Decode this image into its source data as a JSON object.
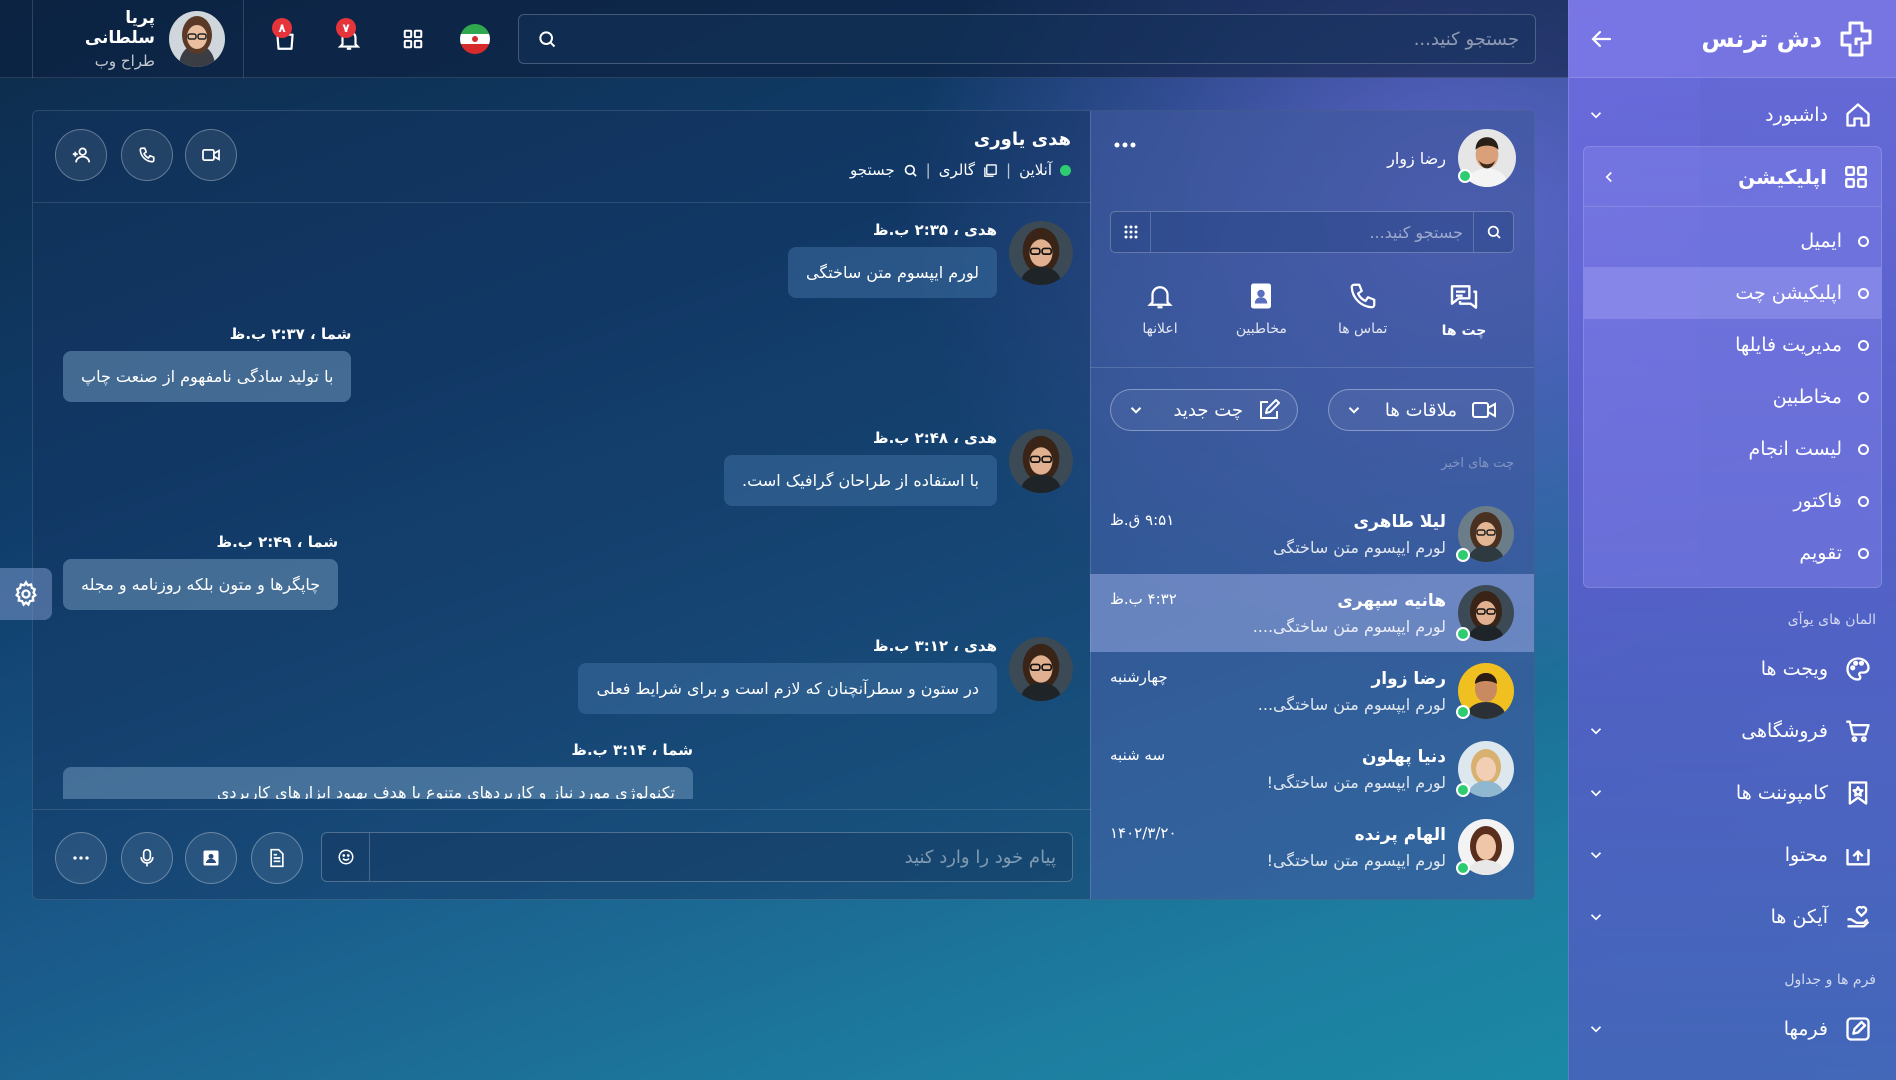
{
  "brand": {
    "name": "دش ترنس"
  },
  "user": {
    "name": "پریا سلطانی",
    "role": "طراح وب"
  },
  "topbar": {
    "search_placeholder": "جستجو کنید...",
    "badges": {
      "shop": "۸",
      "bell": "۷"
    }
  },
  "sidebar": {
    "dashboard": "داشبورد",
    "apps": {
      "label": "اپلیکیشن",
      "items": [
        "ایمیل",
        "اپلیکیشن چت",
        "مدیریت فایلها",
        "مخاطبین",
        "لیست انجام",
        "فاکتور",
        "تقویم"
      ],
      "active_index": 1
    },
    "section_ui": "المان های یوآی",
    "ui_items": [
      "ویجت ها",
      "فروشگاهی",
      "کامپوننت ها",
      "محتوا",
      "آیکن ها"
    ],
    "section_forms": "فرم ها و جداول",
    "forms_item": "فرمها"
  },
  "contacts": {
    "me": "رضا زوار",
    "search_placeholder": "جستجو کنید...",
    "tabs": [
      "چت ها",
      "تماس ها",
      "مخاطبین",
      "اعلانها"
    ],
    "meetings": "ملاقات ها",
    "new_chat": "چت جدید",
    "recent_label": "چت های اخیر",
    "list": [
      {
        "name": "لیلا طاهری",
        "msg": "لورم ایپسوم متن ساختگی",
        "time": "۹:۵۱ ق.ظ"
      },
      {
        "name": "هانیه سپهری",
        "msg": "لورم ایپسوم متن ساختگی....",
        "time": "۴:۳۲ ب.ظ"
      },
      {
        "name": "رضا زوار",
        "msg": "لورم ایپسوم متن ساختگی...",
        "time": "چهارشنبه"
      },
      {
        "name": "دنیا پهلون",
        "msg": "لورم ایپسوم متن ساختگی!",
        "time": "سه شنبه"
      },
      {
        "name": "الهام پرنده",
        "msg": "لورم ایپسوم متن ساختگی!",
        "time": "۱۴۰۲/۳/۲۰"
      }
    ]
  },
  "chat": {
    "name": "هدی یاوری",
    "status": "آنلاین",
    "gallery": "گالری",
    "search": "جستجو",
    "messages": [
      {
        "who": "هدی ، ۲:۳۵ ب.ظ",
        "text": "لورم ایپسوم متن ساختگی"
      },
      {
        "who": "شما ، ۲:۳۷ ب.ظ",
        "text": "با تولید سادگی نامفهوم از صنعت چاپ"
      },
      {
        "who": "هدی ، ۲:۴۸ ب.ظ",
        "text": "با استفاده از طراحان گرافیک است."
      },
      {
        "who": "شما ، ۲:۴۹ ب.ظ",
        "text": "چاپگرها و متون بلکه روزنامه و مجله"
      },
      {
        "who": "هدی ، ۳:۱۲ ب.ظ",
        "text": "در ستون و سطرآنچنان که لازم است و برای شرایط فعلی"
      },
      {
        "who": "شما ، ۳:۱۴ ب.ظ",
        "text": "تکنولوژی مورد نیاز و کاربردهای متنوع با هدف بهبود ابزارهای کاربردی"
      }
    ],
    "input_placeholder": "پیام خود را وارد کنید"
  },
  "colors": {
    "accent": "#6f6fe0",
    "online": "#2ecc71",
    "badge": "#e5343a"
  }
}
